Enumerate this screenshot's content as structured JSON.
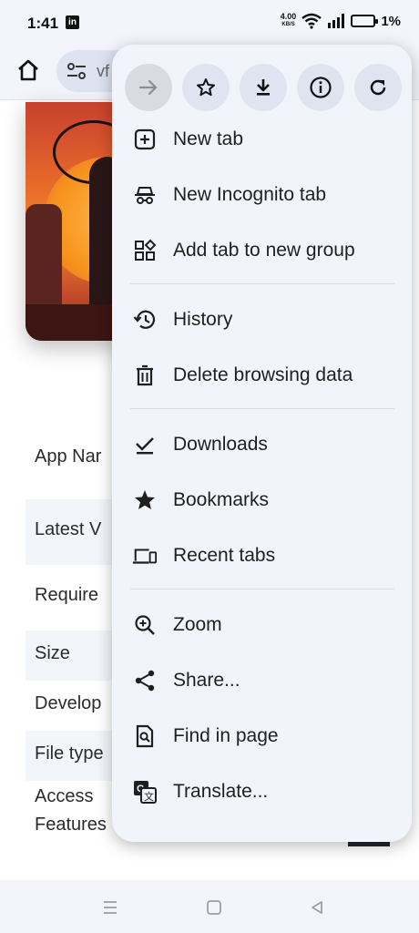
{
  "status_bar": {
    "time": "1:41",
    "net_speed": "4.00",
    "net_speed_unit": "KB/S",
    "battery": "1%"
  },
  "toolbar": {
    "url_fragment": "vf"
  },
  "content": {
    "rows": [
      {
        "label": "App Nar"
      },
      {
        "label": "Latest V"
      },
      {
        "label": "Require"
      },
      {
        "label": "Size"
      },
      {
        "label": "Develop"
      },
      {
        "label": "File type"
      },
      {
        "label": "Access"
      },
      {
        "label": "Features"
      }
    ]
  },
  "menu": {
    "items": [
      {
        "label": "New tab",
        "icon": "new-tab-icon"
      },
      {
        "label": "New Incognito tab",
        "icon": "incognito-icon"
      },
      {
        "label": "Add tab to new group",
        "icon": "tab-group-icon"
      },
      {
        "label": "History",
        "icon": "history-icon"
      },
      {
        "label": "Delete browsing data",
        "icon": "trash-icon"
      },
      {
        "label": "Downloads",
        "icon": "downloads-icon"
      },
      {
        "label": "Bookmarks",
        "icon": "star-filled-icon"
      },
      {
        "label": "Recent tabs",
        "icon": "devices-icon"
      },
      {
        "label": "Zoom",
        "icon": "zoom-icon"
      },
      {
        "label": "Share...",
        "icon": "share-icon"
      },
      {
        "label": "Find in page",
        "icon": "find-in-page-icon"
      },
      {
        "label": "Translate...",
        "icon": "translate-icon"
      }
    ]
  }
}
